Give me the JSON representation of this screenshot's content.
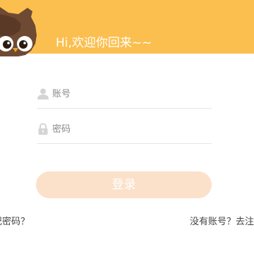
{
  "header": {
    "welcome_text": "Hi,欢迎你回来~~",
    "background_color": "#fbbf4f",
    "mascot_icon": "owl-mascot-icon"
  },
  "form": {
    "username_placeholder": "账号",
    "username_icon": "user-icon",
    "password_placeholder": "密码",
    "password_icon": "lock-icon"
  },
  "actions": {
    "login_label": "登录",
    "login_color": "#fbe1c9",
    "forgot_password_label": "忘记密码？",
    "register_label": "没有账号？去注册"
  }
}
